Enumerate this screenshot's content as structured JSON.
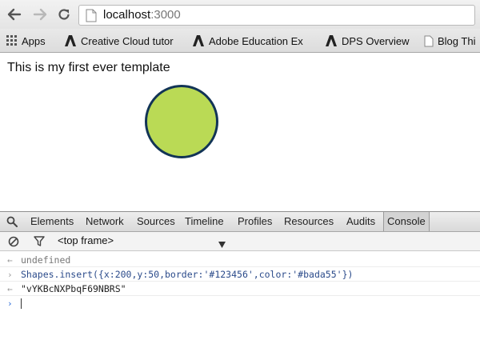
{
  "browser": {
    "url_host": "localhost",
    "url_port": ":3000",
    "bookmarks": [
      {
        "label": "Apps",
        "icon": "apps-grid-icon"
      },
      {
        "label": "Creative Cloud tutor",
        "icon": "adobe-logo-icon"
      },
      {
        "label": "Adobe Education Ex",
        "icon": "adobe-logo-icon"
      },
      {
        "label": "DPS Overview",
        "icon": "adobe-logo-icon"
      },
      {
        "label": "Blog Thi",
        "icon": "page-icon"
      }
    ]
  },
  "page": {
    "heading": "This is my first ever template",
    "shape": {
      "border": "#123456",
      "color": "#bada55"
    }
  },
  "devtools": {
    "tabs": [
      "Elements",
      "Network",
      "Sources",
      "Timeline",
      "Profiles",
      "Resources",
      "Audits",
      "Console"
    ],
    "active_tab": "Console",
    "frame_select": "<top frame>",
    "console": [
      {
        "kind": "result",
        "text": "undefined"
      },
      {
        "kind": "command",
        "text": "Shapes.insert({x:200,y:50,border:'#123456',color:'#bada55'})"
      },
      {
        "kind": "result",
        "text": "\"vYKBcNXPbqF69NBRS\""
      }
    ]
  },
  "colors": {
    "accent_prompt": "#2a6ad8",
    "shape_fill": "#bada55",
    "shape_border": "#123456"
  }
}
